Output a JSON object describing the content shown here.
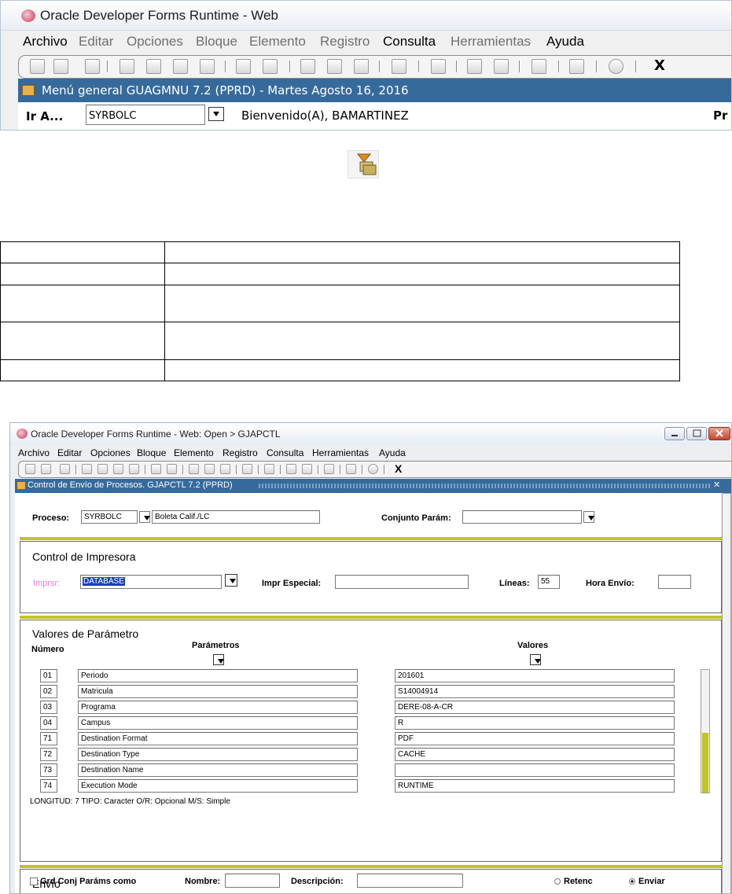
{
  "top_window": {
    "title": "Oracle Developer Forms Runtime - Web",
    "menu": [
      "Archivo",
      "Editar",
      "Opciones",
      "Bloque",
      "Elemento",
      "Registro",
      "Consulta",
      "Herramientas",
      "Ayuda"
    ],
    "toolbar_close": "X",
    "header": "Menú general  GUAGMNU  7.2  (PPRD) - Martes Agosto 16, 2016",
    "goto_label": "Ir A...",
    "goto_value": "SYRBOLC",
    "welcome": "Bienvenido(A), BAMARTINEZ",
    "right_cut": "Pr"
  },
  "bottom_window": {
    "title": "Oracle Developer Forms Runtime - Web:  Open > GJAPCTL",
    "menu": [
      "Archivo",
      "Editar",
      "Opciones",
      "Bloque",
      "Elemento",
      "Registro",
      "Consulta",
      "Herramientas",
      "Ayuda"
    ],
    "toolbar_close": "X",
    "header": "Control de Envío de Procesos.  GJAPCTL  7.2  (PPRD)",
    "proceso_label": "Proceso:",
    "proceso_value": "SYRBOLC",
    "proceso_desc": "Boleta Calif./LC",
    "conjunto_label": "Conjunto Parám:",
    "conjunto_value": "",
    "printer_section": "Control de Impresora",
    "imprsr_label": "Imprsr:",
    "imprsr_value": "DATABASE",
    "impr_especial_label": "Impr Especial:",
    "impr_especial_value": "",
    "lineas_label": "Líneas:",
    "lineas_value": "55",
    "hora_envio_label": "Hora Envío:",
    "hora_envio_value": "",
    "param_section": "Valores de Parámetro",
    "numero_header": "Número",
    "parametros_header": "Parámetros",
    "valores_header": "Valores",
    "params": [
      {
        "num": "01",
        "name": "Periodo",
        "value": "201601"
      },
      {
        "num": "02",
        "name": "Matricula",
        "value": "S14004914"
      },
      {
        "num": "03",
        "name": "Programa",
        "value": "DERE-08-A-CR"
      },
      {
        "num": "04",
        "name": "Campus",
        "value": "R"
      },
      {
        "num": "71",
        "name": "Destination Format",
        "value": "PDF"
      },
      {
        "num": "72",
        "name": "Destination Type",
        "value": "CACHE"
      },
      {
        "num": "73",
        "name": "Destination Name",
        "value": ""
      },
      {
        "num": "74",
        "name": "Execution Mode",
        "value": "RUNTIME"
      }
    ],
    "hint": "LONGITUD: 7 TIPO: Caracter O/R: Opcional M/S: Simple",
    "envio_section": "Envío",
    "grd_label": "Grd Conj Paráms como",
    "nombre_label": "Nombre:",
    "descripcion_label": "Descripción:",
    "retenc_label": "Retenc",
    "enviar_label": "Enviar"
  }
}
